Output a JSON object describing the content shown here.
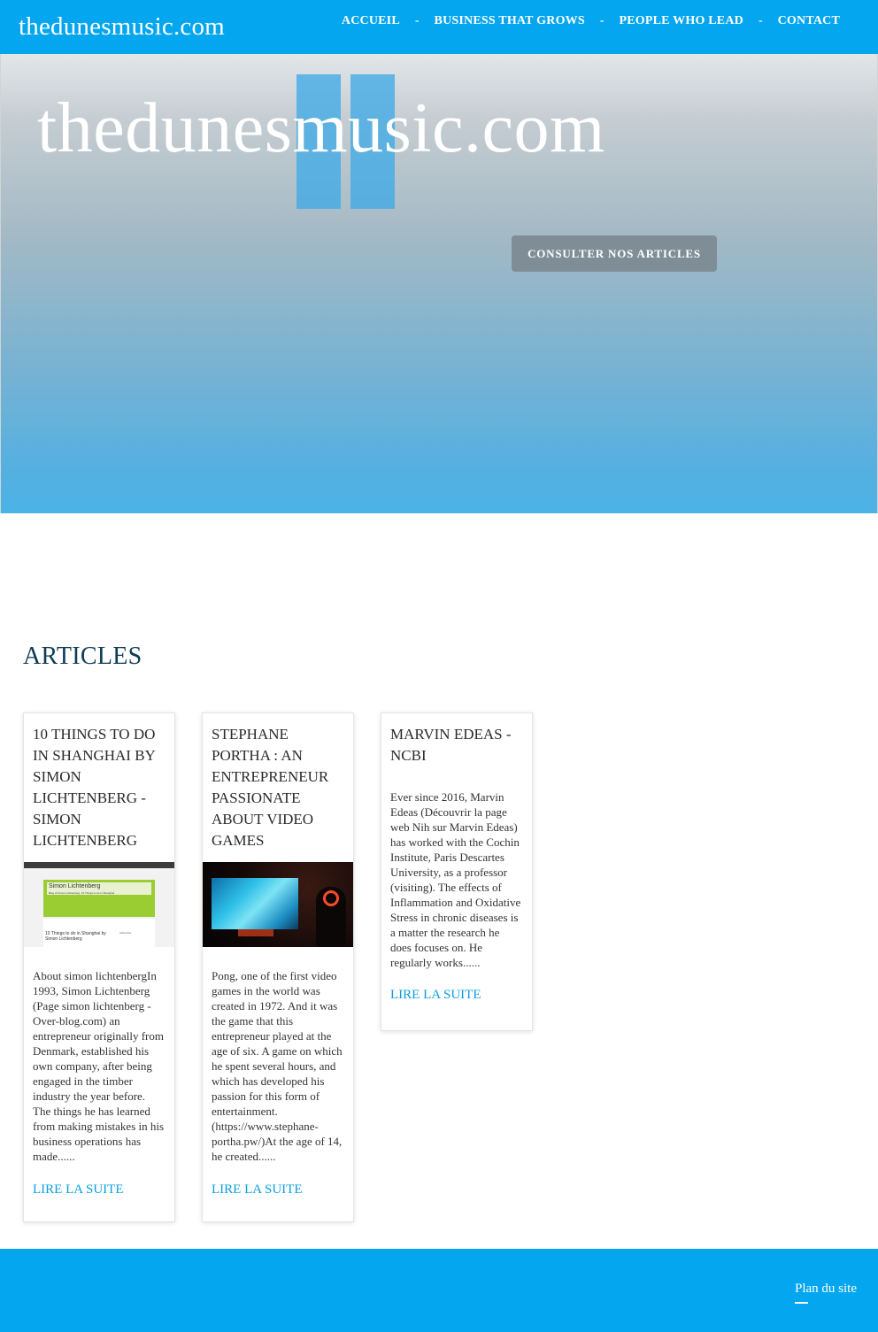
{
  "header": {
    "site_title": "thedunesmusic.com",
    "nav": [
      {
        "label": "ACCUEIL"
      },
      {
        "label": "BUSINESS THAT GROWS"
      },
      {
        "label": "PEOPLE WHO LEAD"
      },
      {
        "label": "CONTACT"
      }
    ],
    "separator": "-"
  },
  "hero": {
    "title": "thedunesmusic.com",
    "button_label": "CONSULTER NOS ARTICLES"
  },
  "articles": {
    "heading": "ARTICLES",
    "items": [
      {
        "title": "10 THINGS TO DO IN SHANGHAI BY SIMON LICHTENBERG - SIMON LICHTENBERG",
        "image": {
          "blog_name": "Simon Lichtenberg",
          "blog_tagline": "Blog of Simon Lichtenberg, 10 Things to do in Shanghai",
          "post_title": "10 Things to do in Shanghai by Simon Lichtenberg",
          "sidebar_label": "Subscribe"
        },
        "excerpt": "About simon lichtenbergIn 1993, Simon Lichtenberg (Page simon lichtenberg - Over-blog.com) an entrepreneur originally from Denmark, established his own company, after being engaged in the timber industry the year before. The things he has learned from making mistakes in his business operations has made......",
        "more": "LIRE LA SUITE"
      },
      {
        "title": "STEPHANE PORTHA : AN ENTREPRENEUR PASSIONATE ABOUT VIDEO GAMES",
        "image": {},
        "excerpt": "Pong, one of the first video games in the world was created in 1972. And it was the game that this entrepreneur played at the age of six. A game on which he spent several hours, and which has developed his passion for this form of entertainment. (https://www.stephane-portha.pw/)At the age of 14, he created......",
        "more": "LIRE LA SUITE"
      },
      {
        "title": "MARVIN EDEAS - NCBI",
        "excerpt": "Ever since 2016, Marvin Edeas (Découvrir la page web Nih sur Marvin Edeas) has worked with the Cochin Institute, Paris Descartes University, as a professor (visiting). The effects of Inflammation and Oxidative Stress in chronic diseases is a matter the research he does focuses on. He regularly works......",
        "more": "LIRE LA SUITE"
      }
    ]
  },
  "footer": {
    "sitemap_label": "Plan du site"
  },
  "colors": {
    "brand_blue": "#03a6ef",
    "link_blue": "#0aa0df",
    "heading_navy": "#0e3b55",
    "button_gray": "#7f8e96"
  }
}
